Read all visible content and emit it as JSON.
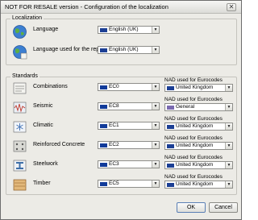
{
  "window": {
    "title": "NOT FOR RESALE version - Configuration of the localization",
    "close_glyph": "✕"
  },
  "localization": {
    "title": "Localization",
    "rows": [
      {
        "label": "Language",
        "value": "English (UK)",
        "flag": "flag-uk"
      },
      {
        "label": "Language used for the report",
        "value": "English (UK)",
        "flag": "flag-uk"
      }
    ]
  },
  "standards": {
    "title": "Standards",
    "nad_label": "NAD used for Eurocodes",
    "rows": [
      {
        "label": "Combinations",
        "code": "EC0",
        "nad": "United Kingdom",
        "nad_flag": "flag-uk"
      },
      {
        "label": "Seismic",
        "code": "EC8",
        "nad": "General",
        "nad_flag": "flag-gen"
      },
      {
        "label": "Climatic",
        "code": "EC1",
        "nad": "United Kingdom",
        "nad_flag": "flag-uk"
      },
      {
        "label": "Reinforced Concrete",
        "code": "EC2",
        "nad": "United Kingdom",
        "nad_flag": "flag-uk"
      },
      {
        "label": "Steelwork",
        "code": "EC3",
        "nad": "United Kingdom",
        "nad_flag": "flag-uk"
      },
      {
        "label": "Timber",
        "code": "EC5",
        "nad": "United Kingdom",
        "nad_flag": "flag-uk"
      }
    ]
  },
  "buttons": {
    "ok": "OK",
    "cancel": "Cancel"
  },
  "icons": {
    "language": "globe-icon",
    "report_language": "globe-report-icon",
    "combinations": "combinations-icon",
    "seismic": "seismic-icon",
    "climatic": "climatic-icon",
    "concrete": "concrete-icon",
    "steelwork": "steelwork-icon",
    "timber": "timber-icon"
  },
  "colors": {
    "window_bg": "#ecebe6",
    "flag_uk": "#1c3f94",
    "flag_eu": "#113b9a",
    "flag_general": "#7a6ab0"
  }
}
